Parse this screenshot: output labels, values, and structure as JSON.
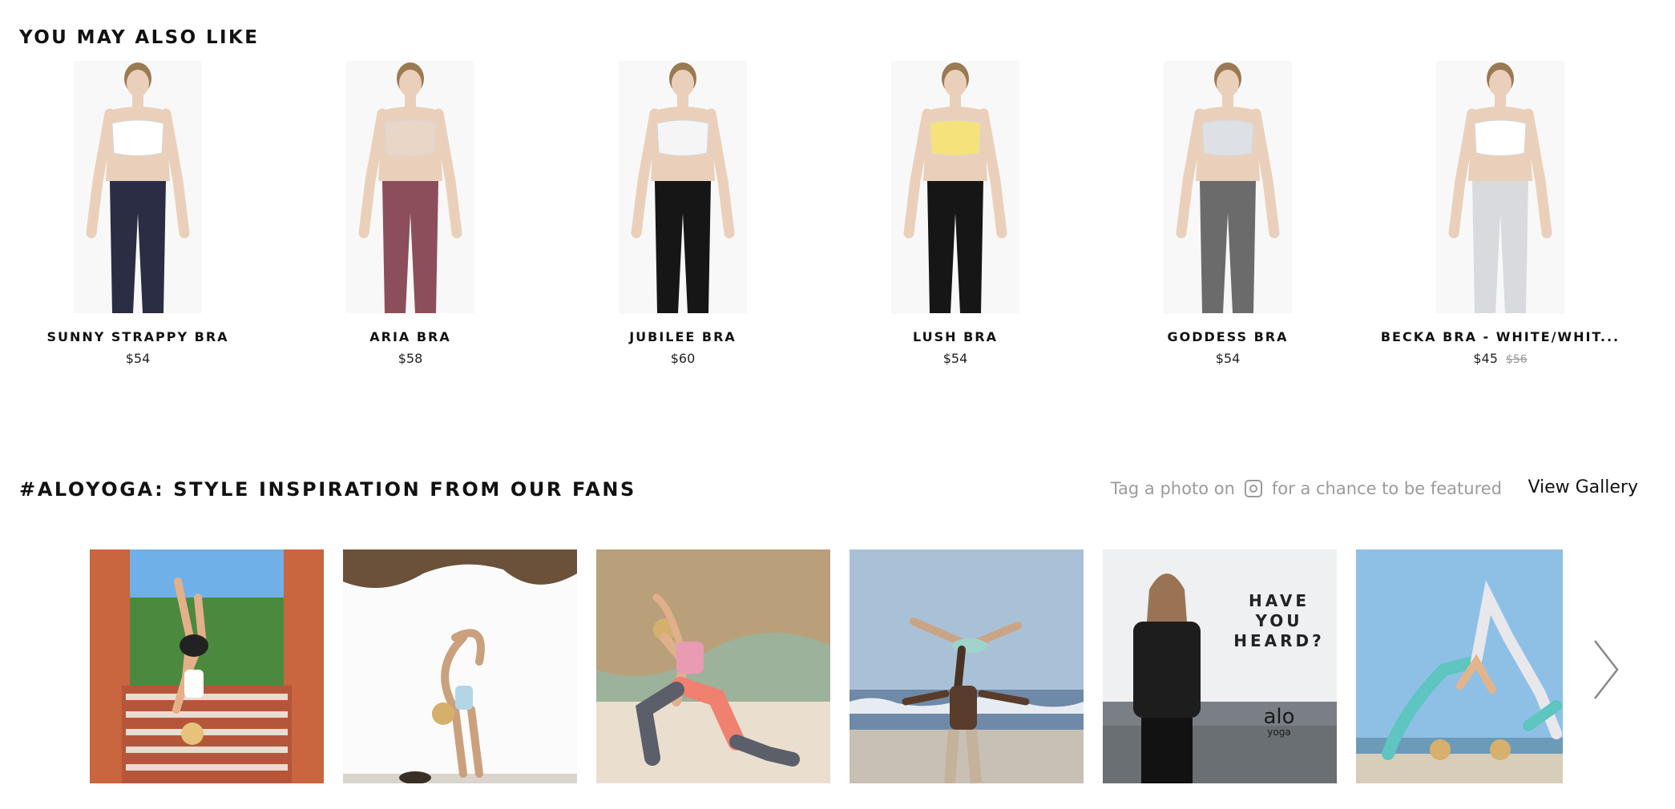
{
  "recommendations": {
    "title": "YOU MAY ALSO LIKE",
    "products": [
      {
        "name": "SUNNY STRAPPY BRA",
        "price": "$54",
        "top_color": "#ffffff",
        "bottom_color": "#2a2d44"
      },
      {
        "name": "ARIA BRA",
        "price": "$58",
        "top_color": "#ead6c6",
        "bottom_color": "#8c4e5a"
      },
      {
        "name": "JUBILEE BRA",
        "price": "$60",
        "top_color": "#f5f5f5",
        "bottom_color": "#161616"
      },
      {
        "name": "LUSH BRA",
        "price": "$54",
        "top_color": "#f6e27a",
        "bottom_color": "#161616"
      },
      {
        "name": "GODDESS BRA",
        "price": "$54",
        "top_color": "#dde0e4",
        "bottom_color": "#6b6b6b"
      },
      {
        "name": "BECKA BRA - WHITE/WHIT...",
        "price": "$45",
        "original_price": "$56",
        "top_color": "#ffffff",
        "bottom_color": "#d9dadd"
      }
    ]
  },
  "fans": {
    "title": "#ALOYOGA: STYLE INSPIRATION FROM OUR FANS",
    "tag_before": "Tag a photo on",
    "tag_after": "for a chance to be featured",
    "instagram_icon": "instagram-icon",
    "view_gallery": "View Gallery",
    "tiles": [
      {
        "subject": "handstand on tiled staircase"
      },
      {
        "subject": "backbend in sea cave"
      },
      {
        "subject": "lunge pose on beach"
      },
      {
        "subject": "acro yoga couple on beach"
      },
      {
        "subject": "ad tile",
        "ad_lines": [
          "HAVE",
          "YOU",
          "HEARD?"
        ],
        "logo": "alo",
        "logo_sub": "yoga"
      },
      {
        "subject": "two women arch pose on beach"
      }
    ],
    "next_icon": "chevron-right-icon"
  },
  "colors": {
    "text": "#111111",
    "muted": "#9b9b9b"
  }
}
